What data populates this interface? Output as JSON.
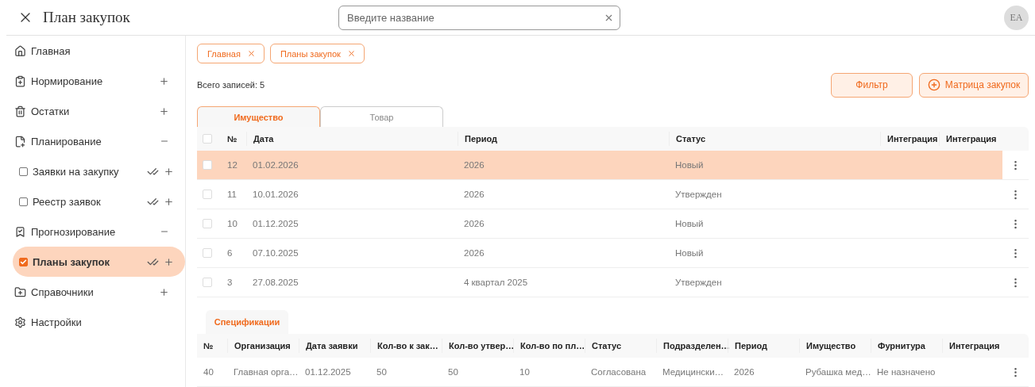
{
  "header": {
    "title": "План закупок",
    "search": {
      "placeholder": "Введите название"
    },
    "avatar": "EA"
  },
  "sidebar": {
    "items": [
      {
        "label": "Главная",
        "kind": "link"
      },
      {
        "label": "Нормирование",
        "kind": "section",
        "expanded": false
      },
      {
        "label": "Остатки",
        "kind": "section",
        "expanded": false
      },
      {
        "label": "Планирование",
        "kind": "section",
        "expanded": true,
        "children": [
          {
            "label": "Заявки на закупку",
            "checked": false,
            "selected": false
          },
          {
            "label": "Реестр заявок",
            "checked": false,
            "selected": false
          }
        ]
      },
      {
        "label": "Прогнозирование",
        "kind": "section",
        "expanded": true,
        "children": [
          {
            "label": "Планы закупок",
            "checked": true,
            "selected": true
          }
        ]
      },
      {
        "label": "Справочники",
        "kind": "section",
        "expanded": false
      },
      {
        "label": "Настройки",
        "kind": "link"
      }
    ]
  },
  "open_tabs": [
    "Главная",
    "Планы закупок"
  ],
  "total": "Всего записей: 5",
  "buttons": {
    "filter": "Фильтр",
    "matrix": "Матрица закупок"
  },
  "table_tabs": [
    {
      "label": "Имущество",
      "selected": true
    },
    {
      "label": "Товар",
      "selected": false
    }
  ],
  "table": {
    "select_all_checked": false,
    "columns": [
      "№",
      "Дата",
      "Период",
      "Статус",
      "Интеграция",
      "Интеграция"
    ],
    "rows": [
      {
        "cells": [
          "12",
          "01.02.2026",
          "2026",
          "Новый",
          "",
          ""
        ],
        "selected": true,
        "checked": false
      },
      {
        "cells": [
          "11",
          "10.01.2026",
          "2026",
          "Утвержден",
          "",
          ""
        ],
        "selected": false,
        "checked": false
      },
      {
        "cells": [
          "10",
          "01.12.2025",
          "2026",
          "Новый",
          "",
          ""
        ],
        "selected": false,
        "checked": false
      },
      {
        "cells": [
          "6",
          "07.10.2025",
          "2026",
          "Новый",
          "",
          ""
        ],
        "selected": false,
        "checked": false
      },
      {
        "cells": [
          "3",
          "27.08.2025",
          "4 квартал 2025",
          "Утвержден",
          "",
          ""
        ],
        "selected": false,
        "checked": false
      }
    ]
  },
  "spec_tabs": [
    {
      "label": "Спецификации",
      "selected": true
    }
  ],
  "spec_table": {
    "columns": [
      "№",
      "Организация",
      "Дата заявки",
      "Кол-во к зак…",
      "Кол-во утвер…",
      "Кол-во по пл…",
      "Статус",
      "Подразделен…",
      "Период",
      "Имущество",
      "Фурнитура",
      "Интеграция"
    ],
    "rows": [
      {
        "cells": [
          "40",
          "Главная орга…",
          "01.12.2025",
          "50",
          "50",
          "10",
          "Согласована",
          "Медицински…",
          "2026",
          "Рубашка мед…",
          "Не назначено",
          ""
        ]
      }
    ]
  }
}
